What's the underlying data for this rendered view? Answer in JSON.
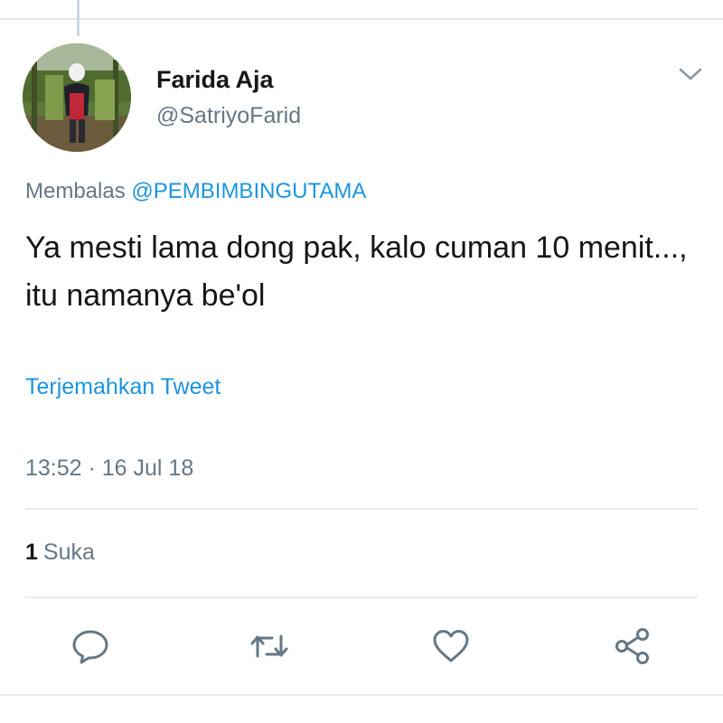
{
  "author": {
    "display_name": "Farida Aja",
    "handle": "@SatriyoFarid"
  },
  "reply_context": {
    "prefix": "Membalas",
    "mention": "@PEMBIMBINGUTAMA"
  },
  "tweet": {
    "text": "Ya mesti lama dong pak, kalo cuman 10 menit..., itu namanya be'ol",
    "translate_label": "Terjemahkan Tweet",
    "timestamp": "13:52 · 16 Jul 18"
  },
  "engagement": {
    "like_count": "1",
    "like_label": "Suka"
  },
  "actions": [
    "reply-icon",
    "retweet-icon",
    "heart-icon",
    "share-icon"
  ],
  "colors": {
    "link": "#1b95e0",
    "secondary_text": "#657786",
    "primary_text": "#14171a",
    "divider": "#e6ecf0"
  }
}
